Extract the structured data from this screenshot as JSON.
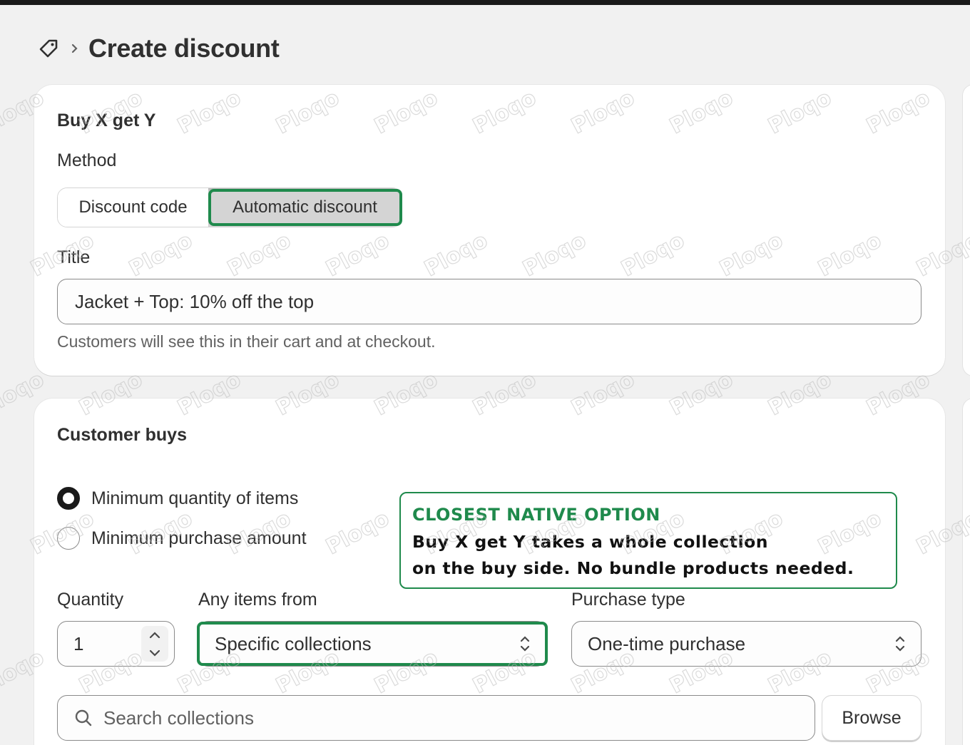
{
  "header": {
    "title": "Create discount",
    "icon": "tag-icon"
  },
  "card1": {
    "title": "Buy X get Y",
    "method_label": "Method",
    "method_options": [
      "Discount code",
      "Automatic discount"
    ],
    "method_selected": "Automatic discount",
    "title_label": "Title",
    "title_value": "Jacket + Top: 10% off the top",
    "title_help": "Customers will see this in their cart and at checkout."
  },
  "card2": {
    "title": "Customer buys",
    "radio_options": [
      "Minimum quantity of items",
      "Minimum purchase amount"
    ],
    "radio_selected": "Minimum quantity of items",
    "quantity_label": "Quantity",
    "quantity_value": "1",
    "items_from_label": "Any items from",
    "items_from_value": "Specific collections",
    "purchase_type_label": "Purchase type",
    "purchase_type_value": "One-time purchase",
    "search_placeholder": "Search collections",
    "browse_label": "Browse"
  },
  "callout": {
    "title": "CLOSEST NATIVE OPTION",
    "line1": "Buy X get Y takes a whole collection",
    "line2": "on the buy side. No bundle products needed."
  },
  "watermark": "Ploqo",
  "colors": {
    "annotation_green": "#1f8a4c",
    "page_bg": "#f1f1f1",
    "card_bg": "#ffffff",
    "text": "#303030"
  }
}
